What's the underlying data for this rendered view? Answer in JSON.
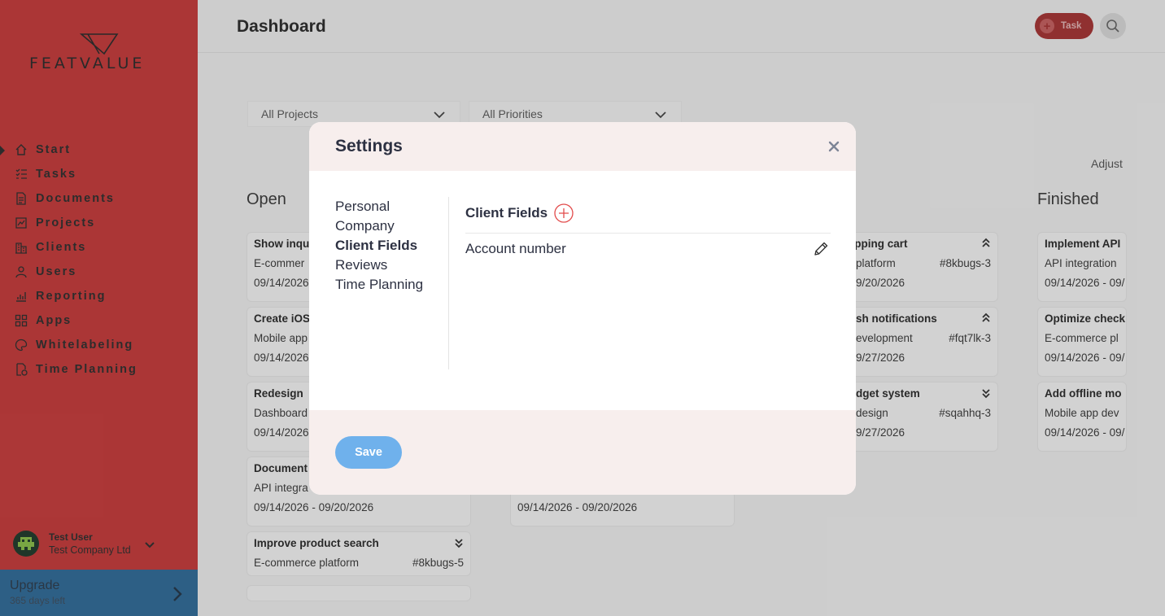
{
  "brand": {
    "logo_text": "FEATVALUE"
  },
  "sidebar": {
    "items": [
      {
        "label": "Start",
        "icon": "home-icon"
      },
      {
        "label": "Tasks",
        "icon": "tasks-icon"
      },
      {
        "label": "Documents",
        "icon": "documents-icon"
      },
      {
        "label": "Projects",
        "icon": "projects-icon"
      },
      {
        "label": "Clients",
        "icon": "clients-icon"
      },
      {
        "label": "Users",
        "icon": "user-icon"
      },
      {
        "label": "Reporting",
        "icon": "chart-icon"
      },
      {
        "label": "Apps",
        "icon": "apps-icon"
      },
      {
        "label": "Whitelabeling",
        "icon": "palette-icon"
      },
      {
        "label": "Time Planning",
        "icon": "time-planning-icon"
      }
    ],
    "user": {
      "name": "Test User",
      "company": "Test Company Ltd"
    },
    "upgrade": {
      "title": "Upgrade",
      "subtitle": "365 days left"
    }
  },
  "header": {
    "title": "Dashboard",
    "task_button": "Task"
  },
  "filters": {
    "projects": "All Projects",
    "priorities": "All Priorities",
    "adjust": "Adjust"
  },
  "board": {
    "open_title": "Open",
    "finished_title": "Finished",
    "open_cards": [
      {
        "title": "Show inqu",
        "project": "E-commer",
        "dates": "09/14/2026"
      },
      {
        "title": "Create iOS",
        "project": "Mobile app",
        "dates": "09/14/2026"
      },
      {
        "title": "Redesign",
        "project": "Dashboard",
        "dates": "09/14/2026"
      },
      {
        "title": "Document",
        "project": "API integra",
        "dates": "09/14/2026 - 09/20/2026"
      },
      {
        "title": "Improve product search",
        "project": "E-commerce platform",
        "id": "#8kbugs-5"
      }
    ],
    "col2_cards": [
      {
        "dates": "09/14/2026 - 09/20/2026"
      }
    ],
    "col3_cards": [
      {
        "title": "opping cart",
        "project": "platform",
        "id": "#8kbugs-3",
        "dates": "9/20/2026"
      },
      {
        "title": "sh notifications",
        "project": "evelopment",
        "id": "#fqt7lk-3",
        "dates": "9/27/2026"
      },
      {
        "title": "dget system",
        "project": "design",
        "id": "#sqahhq-3",
        "dates": "9/27/2026"
      }
    ],
    "finished_cards": [
      {
        "title": "Implement API",
        "project": "API integration",
        "dates": "09/14/2026 - 09/"
      },
      {
        "title": "Optimize check",
        "project": "E-commerce pl",
        "dates": "09/14/2026 - 09/"
      },
      {
        "title": "Add offline mo",
        "project": "Mobile app dev",
        "dates": "09/14/2026 - 09/"
      }
    ]
  },
  "modal": {
    "title": "Settings",
    "menu": [
      "Personal",
      "Company",
      "Client Fields",
      "Reviews",
      "Time Planning"
    ],
    "active_menu": "Client Fields",
    "section_title": "Client Fields",
    "fields": [
      "Account number"
    ],
    "save_label": "Save"
  },
  "colors": {
    "sidebar": "#c93a3a",
    "upgrade": "#2f6c9a",
    "modal_header": "#f7eeed",
    "save_button": "#6fb1ec",
    "add_icon": "#e24b4b"
  }
}
